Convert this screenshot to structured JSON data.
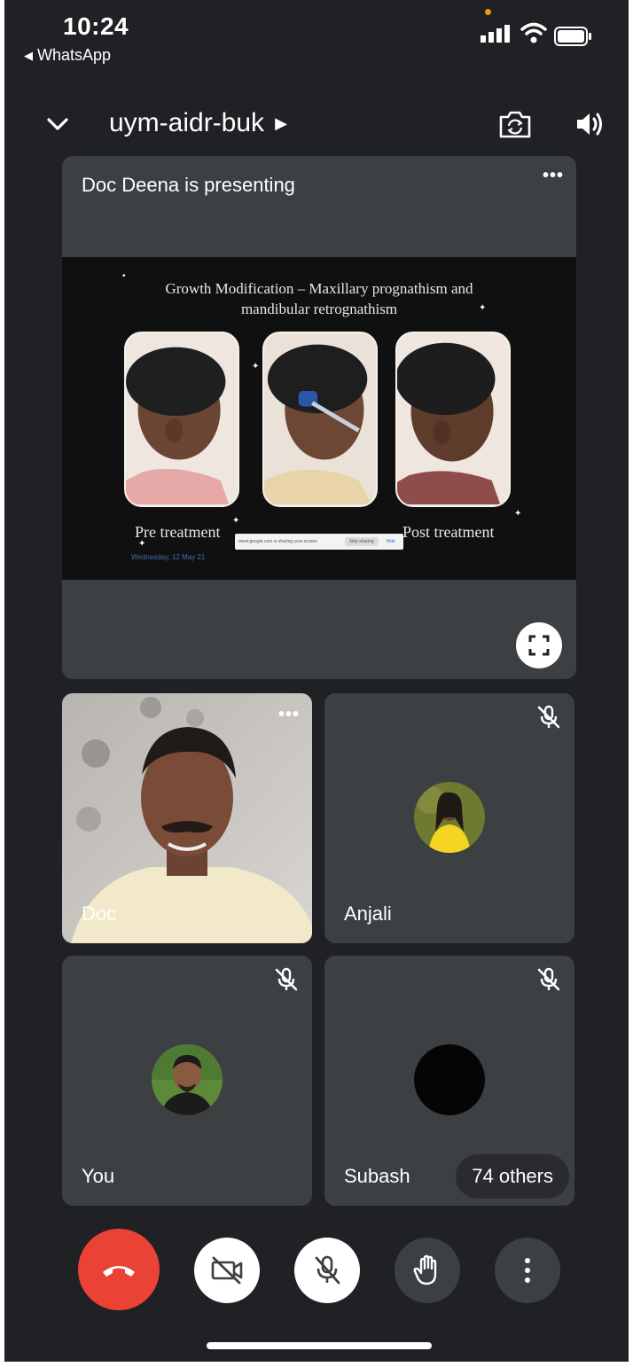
{
  "status_bar": {
    "time": "10:24",
    "back_app": "WhatsApp",
    "icons": [
      "signal-icon",
      "wifi-icon",
      "battery-icon"
    ],
    "recording_dot_color": "#f29900"
  },
  "header": {
    "meeting_code": "uym-aidr-buk",
    "icons": [
      "chevron-down-icon",
      "switch-camera-icon",
      "speaker-icon"
    ]
  },
  "presentation": {
    "title": "Doc Deena is presenting",
    "slide": {
      "title_line1": "Growth Modification – Maxillary prognathism and",
      "title_line2": "mandibular retrognathism",
      "caption_left": "Pre treatment",
      "caption_right": "Post treatment",
      "share_message": "meet.google.com is sharing your screen",
      "share_stop": "Stop sharing",
      "share_hide": "Hide",
      "date": "Wednesday, 12 May 21"
    }
  },
  "participants": [
    {
      "name": "Doc",
      "type": "video",
      "muted": false
    },
    {
      "name": "Anjali",
      "type": "avatar",
      "muted": true
    },
    {
      "name": "You",
      "type": "avatar",
      "muted": true
    },
    {
      "name": "Subash",
      "type": "avatar",
      "muted": true
    }
  ],
  "others_count_label": "74 others",
  "controls": {
    "items": [
      "end-call-button",
      "camera-off-button",
      "mic-off-button",
      "raise-hand-button",
      "more-options-button"
    ],
    "end_call_color": "#ea4335"
  },
  "theme": {
    "background": "#202124",
    "tile": "#3c4043"
  }
}
